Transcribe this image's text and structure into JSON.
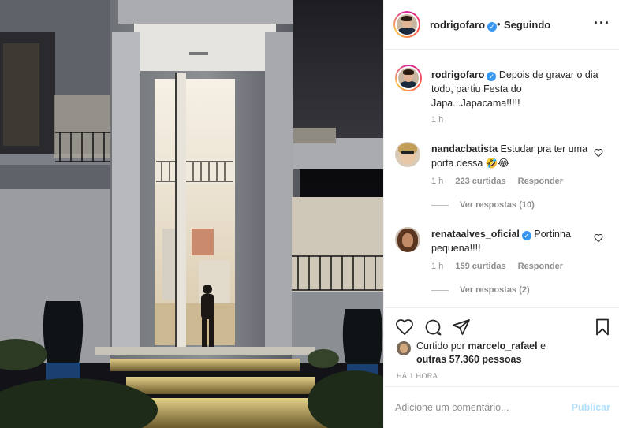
{
  "post": {
    "image_alt": "",
    "author": "rodrigofaro",
    "follow_separator": "•",
    "follow_status": "Seguindo",
    "more_icon": "more-options-icon"
  },
  "caption": {
    "user": "rodrigofaro",
    "text": "Depois de gravar o dia todo, partiu Festa do Japa...Japacama!!!!!",
    "time": "1 h"
  },
  "comments": [
    {
      "user": "nandacbatista",
      "text": "Estudar pra ter uma porta dessa 🤣😂",
      "time": "1 h",
      "likes": "223 curtidas",
      "reply": "Responder",
      "view_replies": "Ver respostas (10)"
    },
    {
      "user": "renataalves_oficial",
      "text": "Portinha pequena!!!!",
      "time": "1 h",
      "likes": "159 curtidas",
      "reply": "Responder",
      "view_replies": "Ver respostas (2)"
    }
  ],
  "likes": {
    "prefix": "Curtido por",
    "user": "marcelo_rafael",
    "and": "e",
    "others": "outras 57.360 pessoas"
  },
  "timestamp": "HÁ 1 HORA",
  "add_comment": {
    "placeholder": "Adicione um comentário...",
    "publish_label": "Publicar"
  },
  "colors": {
    "verified": "#3897f0",
    "publish_disabled": "#b2dffc",
    "meta_gray": "#8e8e8e"
  }
}
